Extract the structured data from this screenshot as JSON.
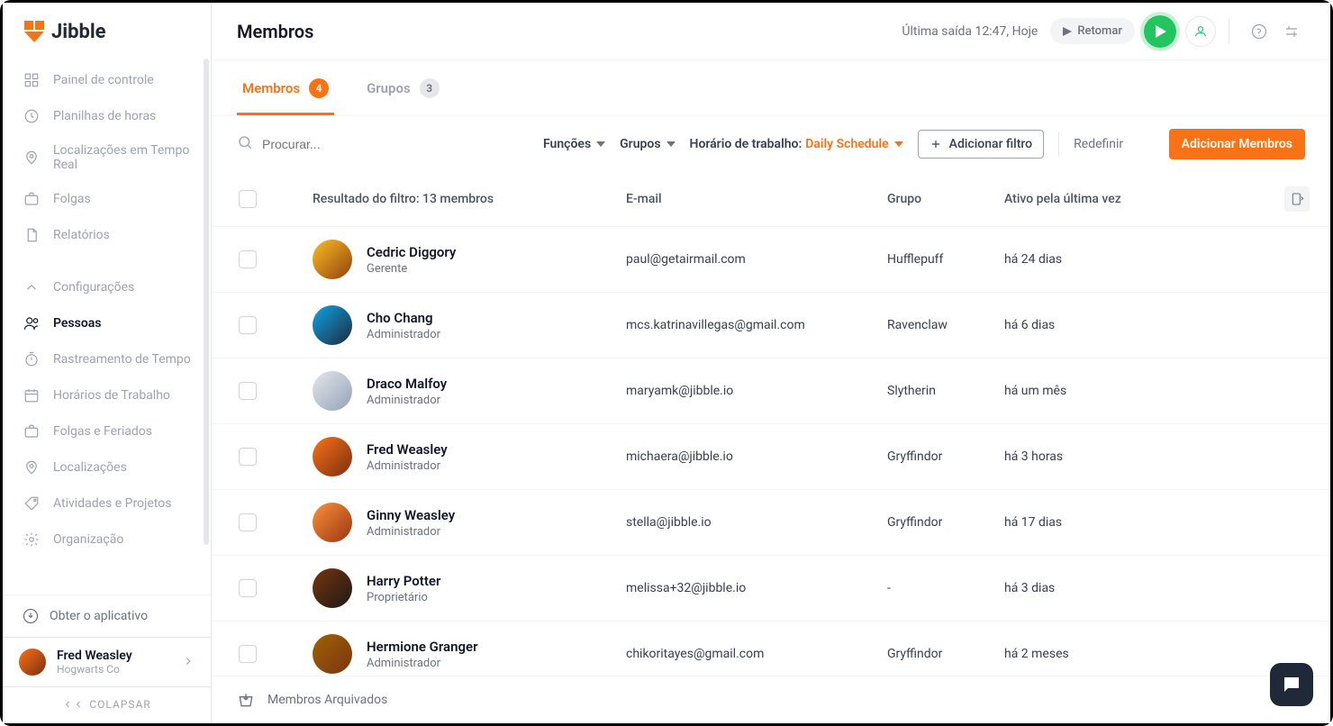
{
  "brand": "Jibble",
  "header": {
    "title": "Membros",
    "last_exit": "Última saída 12:47, Hoje",
    "resume_label": "Retomar"
  },
  "sidebar": {
    "items": [
      {
        "label": "Painel de controle",
        "icon": "dashboard"
      },
      {
        "label": "Planilhas de horas",
        "icon": "clock"
      },
      {
        "label": "Localizações em Tempo Real",
        "icon": "pin"
      },
      {
        "label": "Folgas",
        "icon": "briefcase"
      },
      {
        "label": "Relatórios",
        "icon": "file"
      },
      {
        "label": "Configurações",
        "icon": "chevron-up",
        "gap": true
      },
      {
        "label": "Pessoas",
        "icon": "people",
        "active": true
      },
      {
        "label": "Rastreamento de Tempo",
        "icon": "timer"
      },
      {
        "label": "Horários de Trabalho",
        "icon": "calendar"
      },
      {
        "label": "Folgas e Feriados",
        "icon": "briefcase"
      },
      {
        "label": "Localizações",
        "icon": "pin"
      },
      {
        "label": "Atividades e Projetos",
        "icon": "tag"
      },
      {
        "label": "Organização",
        "icon": "gear"
      }
    ],
    "get_app": "Obter o aplicativo",
    "collapse": "COLAPSAR",
    "user": {
      "name": "Fred Weasley",
      "org": "Hogwarts Co"
    }
  },
  "tabs": {
    "members": {
      "label": "Membros",
      "count": "4"
    },
    "groups": {
      "label": "Grupos",
      "count": "3"
    }
  },
  "filters": {
    "search_placeholder": "Procurar...",
    "roles": "Funções",
    "groups": "Grupos",
    "work_schedule_label": "Horário de trabalho:",
    "work_schedule_value": "Daily Schedule",
    "add_filter": "Adicionar filtro",
    "reset": "Redefinir",
    "add_members": "Adicionar Membros"
  },
  "table": {
    "header": {
      "result": "Resultado do filtro: 13 membros",
      "email": "E-mail",
      "group": "Grupo",
      "last_active": "Ativo pela última vez"
    },
    "rows": [
      {
        "name": "Cedric Diggory",
        "role": "Gerente",
        "email": "paul@getairmail.com",
        "group": "Hufflepuff",
        "last": "há 24 dias"
      },
      {
        "name": "Cho Chang",
        "role": "Administrador",
        "email": "mcs.katrinavillegas@gmail.com",
        "group": "Ravenclaw",
        "last": "há 6 dias"
      },
      {
        "name": "Draco Malfoy",
        "role": "Administrador",
        "email": "maryamk@jibble.io",
        "group": "Slytherin",
        "last": "há um mês"
      },
      {
        "name": "Fred Weasley",
        "role": "Administrador",
        "email": "michaera@jibble.io",
        "group": "Gryffindor",
        "last": "há 3 horas"
      },
      {
        "name": "Ginny Weasley",
        "role": "Administrador",
        "email": "stella@jibble.io",
        "group": "Gryffindor",
        "last": "há 17 dias"
      },
      {
        "name": "Harry Potter",
        "role": "Proprietário",
        "email": "melissa+32@jibble.io",
        "group": "-",
        "last": "há 3 dias"
      },
      {
        "name": "Hermione Granger",
        "role": "Administrador",
        "email": "chikoritayes@gmail.com",
        "group": "Gryffindor",
        "last": "há 2 meses"
      }
    ],
    "archived": "Membros Arquivados"
  }
}
